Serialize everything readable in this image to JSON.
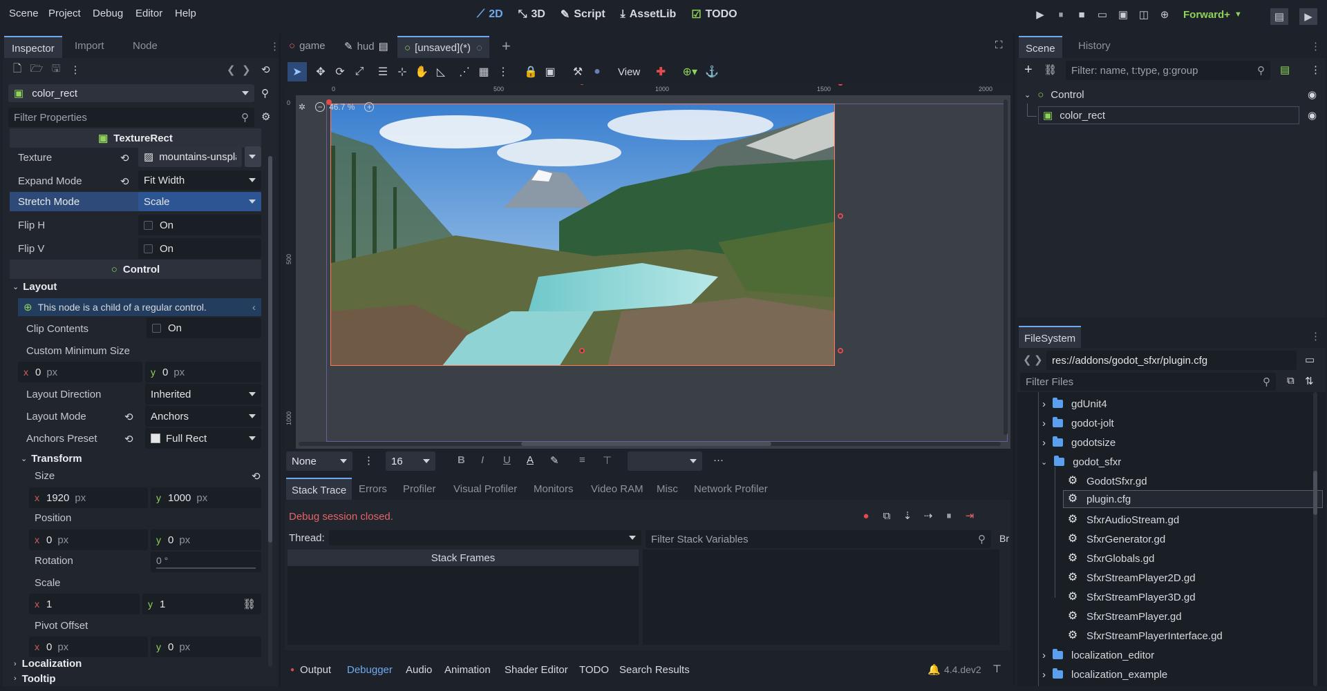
{
  "menu": {
    "items": [
      "Scene",
      "Project",
      "Debug",
      "Editor",
      "Help"
    ]
  },
  "workspaces": {
    "w2d": "2D",
    "w3d": "3D",
    "script": "Script",
    "assetlib": "AssetLib",
    "todo": "TODO"
  },
  "renderer": "Forward+",
  "inspector": {
    "tabs": [
      "Inspector",
      "Import",
      "Node"
    ],
    "node_name": "color_rect",
    "filter_placeholder": "Filter Properties",
    "section_texturerect": "TextureRect",
    "texture_label": "Texture",
    "texture_value": "mountains-unspla",
    "expand_label": "Expand Mode",
    "expand_value": "Fit Width",
    "stretch_label": "Stretch Mode",
    "stretch_value": "Scale",
    "fliph_label": "Flip H",
    "flipv_label": "Flip V",
    "on": "On",
    "section_control": "Control",
    "layout_label": "Layout",
    "child_notice": "This node is a child of a regular control.",
    "clip_label": "Clip Contents",
    "min_size_label": "Custom Minimum Size",
    "min_x": "0",
    "min_y": "0",
    "px": "px",
    "layout_dir_label": "Layout Direction",
    "layout_dir_value": "Inherited",
    "layout_mode_label": "Layout Mode",
    "layout_mode_value": "Anchors",
    "anchors_label": "Anchors Preset",
    "anchors_value": "Full Rect",
    "transform_label": "Transform",
    "size_label": "Size",
    "size_x": "1920",
    "size_y": "1000",
    "position_label": "Position",
    "pos_x": "0",
    "pos_y": "0",
    "rotation_label": "Rotation",
    "rotation_value": "0 °",
    "scale_label": "Scale",
    "scale_x": "1",
    "scale_y": "1",
    "pivot_label": "Pivot Offset",
    "pivot_x": "0",
    "pivot_y": "0",
    "localization_label": "Localization",
    "tooltip_label": "Tooltip",
    "axis_x": "x",
    "axis_y": "y"
  },
  "editor_tabs": [
    "game",
    "hud",
    "[unsaved](*)"
  ],
  "viewport": {
    "view_label": "View",
    "zoom": "46.7 %",
    "ruler_h": [
      "0",
      "500",
      "1000",
      "1500",
      "2000"
    ],
    "ruler_v": [
      "0",
      "500",
      "1000"
    ]
  },
  "text_toolbar": {
    "style": "None",
    "size": "16"
  },
  "debugger": {
    "tabs": [
      "Stack Trace",
      "Errors",
      "Profiler",
      "Visual Profiler",
      "Monitors",
      "Video RAM",
      "Misc",
      "Network Profiler"
    ],
    "status": "Debug session closed.",
    "thread_label": "Thread:",
    "filter_placeholder": "Filter Stack Variables",
    "stack_frames": "Stack Frames",
    "br": "Br"
  },
  "bottom_tabs": [
    "Output",
    "Debugger",
    "Audio",
    "Animation",
    "Shader Editor",
    "TODO",
    "Search Results"
  ],
  "version": "4.4.dev2",
  "scene": {
    "tabs": [
      "Scene",
      "History"
    ],
    "filter_placeholder": "Filter: name, t:type, g:group",
    "root": "Control",
    "child": "color_rect"
  },
  "filesystem": {
    "title": "FileSystem",
    "path": "res://addons/godot_sfxr/plugin.cfg",
    "filter_placeholder": "Filter Files",
    "items": [
      {
        "name": "gdUnit4",
        "type": "folder"
      },
      {
        "name": "godot-jolt",
        "type": "folder"
      },
      {
        "name": "godotsize",
        "type": "folder"
      },
      {
        "name": "godot_sfxr",
        "type": "folder-open"
      },
      {
        "name": "GodotSfxr.gd",
        "type": "file"
      },
      {
        "name": "plugin.cfg",
        "type": "file"
      },
      {
        "name": "SfxrAudioStream.gd",
        "type": "file"
      },
      {
        "name": "SfxrGenerator.gd",
        "type": "file"
      },
      {
        "name": "SfxrGlobals.gd",
        "type": "file"
      },
      {
        "name": "SfxrStreamPlayer2D.gd",
        "type": "file"
      },
      {
        "name": "SfxrStreamPlayer3D.gd",
        "type": "file"
      },
      {
        "name": "SfxrStreamPlayer.gd",
        "type": "file"
      },
      {
        "name": "SfxrStreamPlayerInterface.gd",
        "type": "file"
      },
      {
        "name": "localization_editor",
        "type": "folder"
      },
      {
        "name": "localization_example",
        "type": "folder"
      }
    ]
  },
  "colors": {
    "accent": "#70a9ef",
    "bg": "#1d2129",
    "panel": "#252a33",
    "selection": "#2e4a78",
    "record": "#e34b4b"
  }
}
